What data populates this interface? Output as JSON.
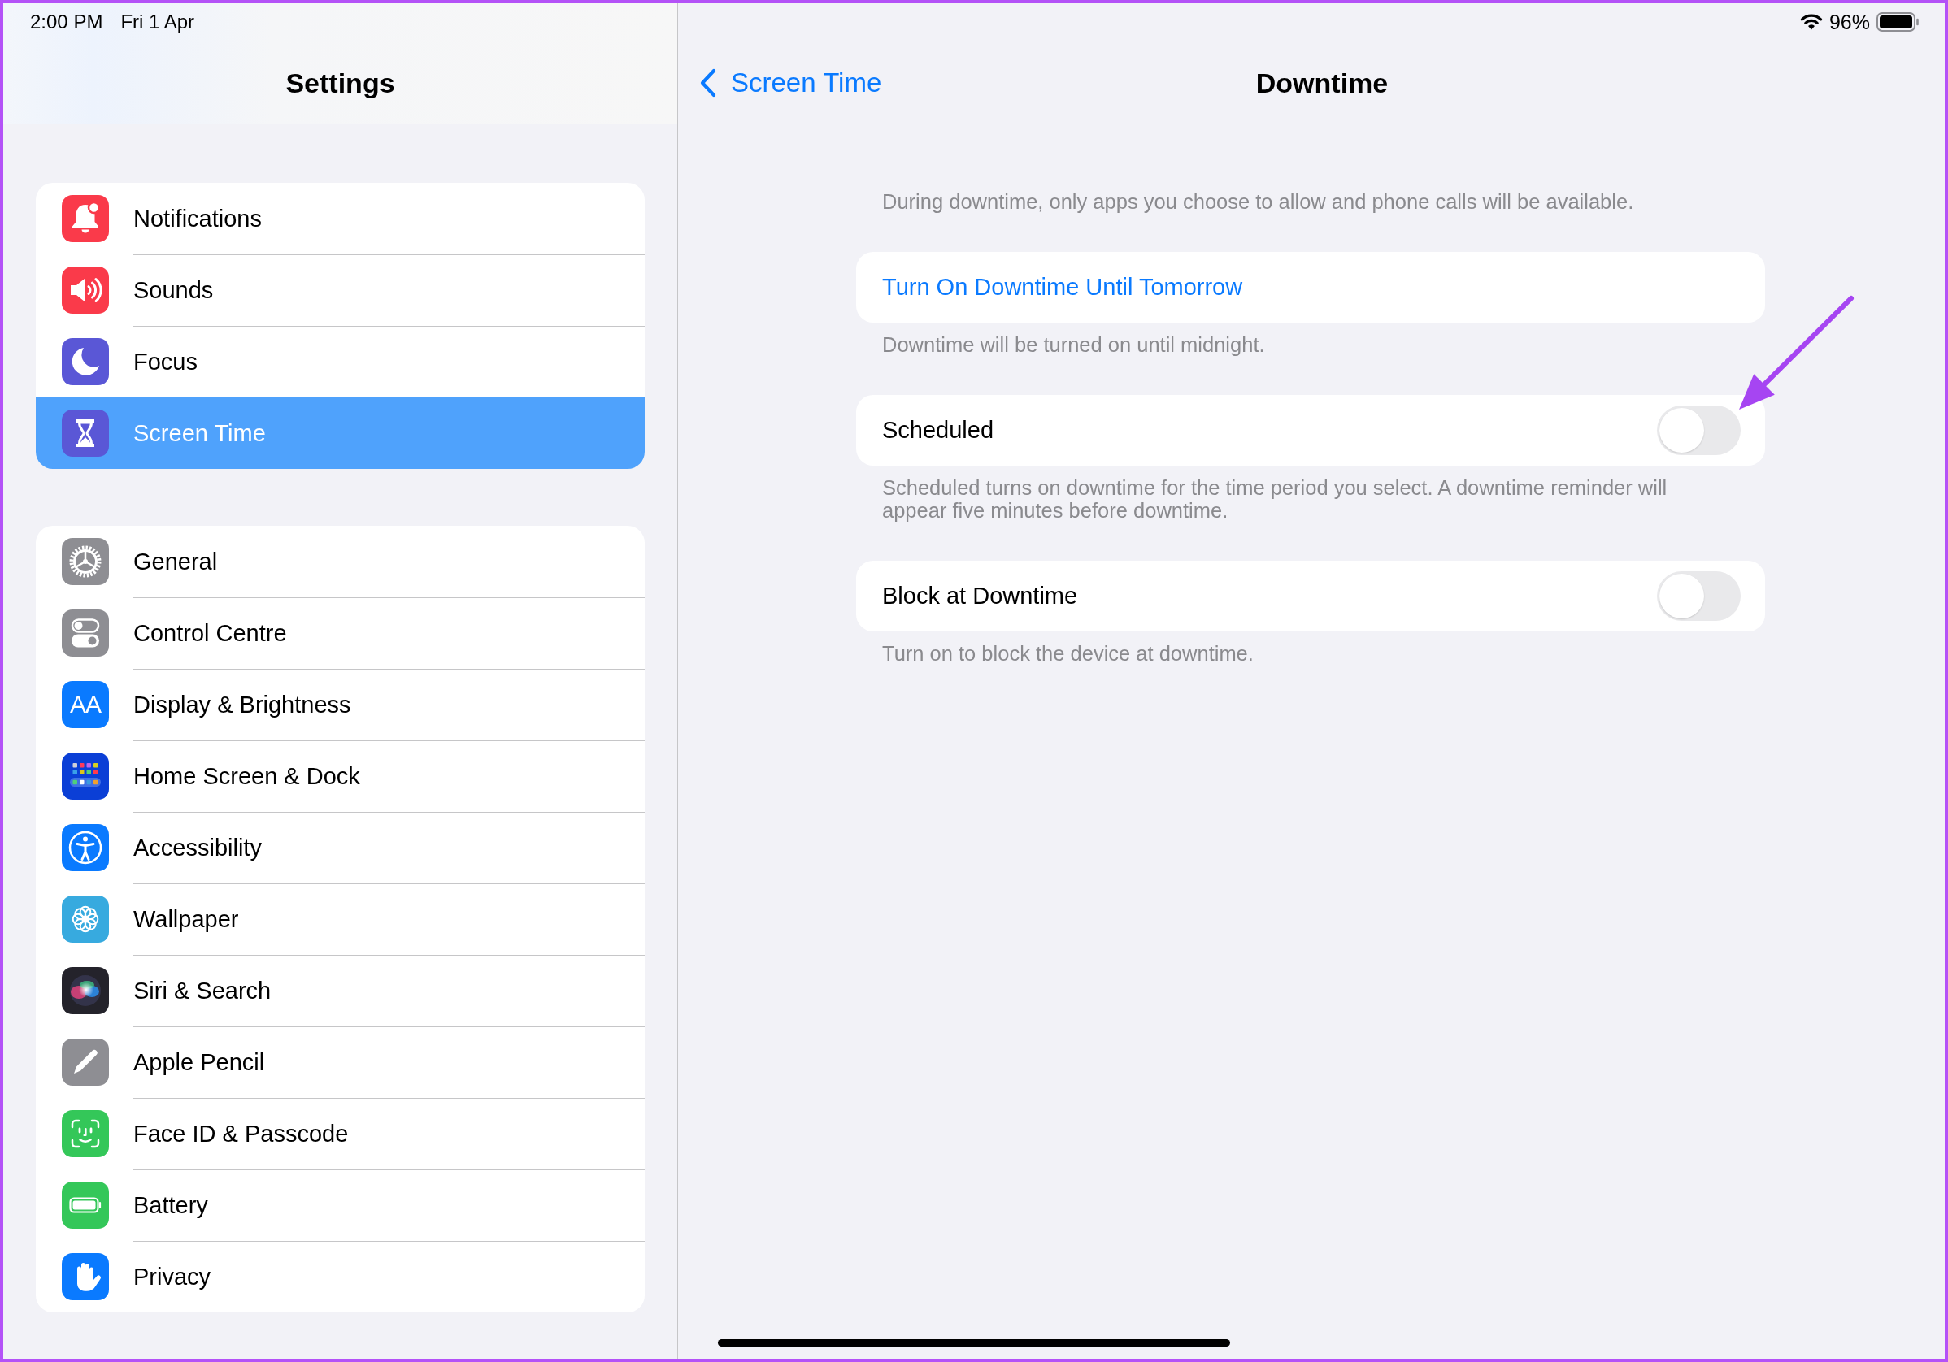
{
  "status_bar": {
    "time": "2:00 PM",
    "date": "Fri 1 Apr",
    "battery": "96%"
  },
  "sidebar": {
    "title": "Settings",
    "groups": [
      {
        "items": [
          {
            "label": "Notifications",
            "color": "#fa3a4a",
            "selected": false
          },
          {
            "label": "Sounds",
            "color": "#fa3a4a",
            "selected": false
          },
          {
            "label": "Focus",
            "color": "#5a57d6",
            "selected": false
          },
          {
            "label": "Screen Time",
            "color": "#5a57d6",
            "selected": true
          }
        ]
      },
      {
        "items": [
          {
            "label": "General",
            "color": "#8e8e93",
            "selected": false
          },
          {
            "label": "Control Centre",
            "color": "#8e8e93",
            "selected": false
          },
          {
            "label": "Display & Brightness",
            "color": "#0a7aff",
            "icon_text": "AA",
            "selected": false
          },
          {
            "label": "Home Screen & Dock",
            "color": "#0b3fd6",
            "selected": false
          },
          {
            "label": "Accessibility",
            "color": "#0a7aff",
            "selected": false
          },
          {
            "label": "Wallpaper",
            "color": "#37aadf",
            "selected": false
          },
          {
            "label": "Siri & Search",
            "color": "#24232b",
            "selected": false
          },
          {
            "label": "Apple Pencil",
            "color": "#8e8e93",
            "selected": false
          },
          {
            "label": "Face ID & Passcode",
            "color": "#34c759",
            "selected": false
          },
          {
            "label": "Battery",
            "color": "#34c759",
            "selected": false
          },
          {
            "label": "Privacy",
            "color": "#0a7aff",
            "selected": false
          }
        ]
      }
    ]
  },
  "detail": {
    "back_label": "Screen Time",
    "title": "Downtime",
    "description": "During downtime, only apps you choose to allow and phone calls will be available.",
    "sections": [
      {
        "kind": "action",
        "label": "Turn On Downtime Until Tomorrow",
        "footer": "Downtime will be turned on until midnight."
      },
      {
        "kind": "toggle",
        "label": "Scheduled",
        "on": false,
        "footer": "Scheduled turns on downtime for the time period you select. A downtime reminder will appear five minutes before downtime."
      },
      {
        "kind": "toggle",
        "label": "Block at Downtime",
        "on": false,
        "footer": "Turn on to block the device at downtime."
      }
    ]
  }
}
